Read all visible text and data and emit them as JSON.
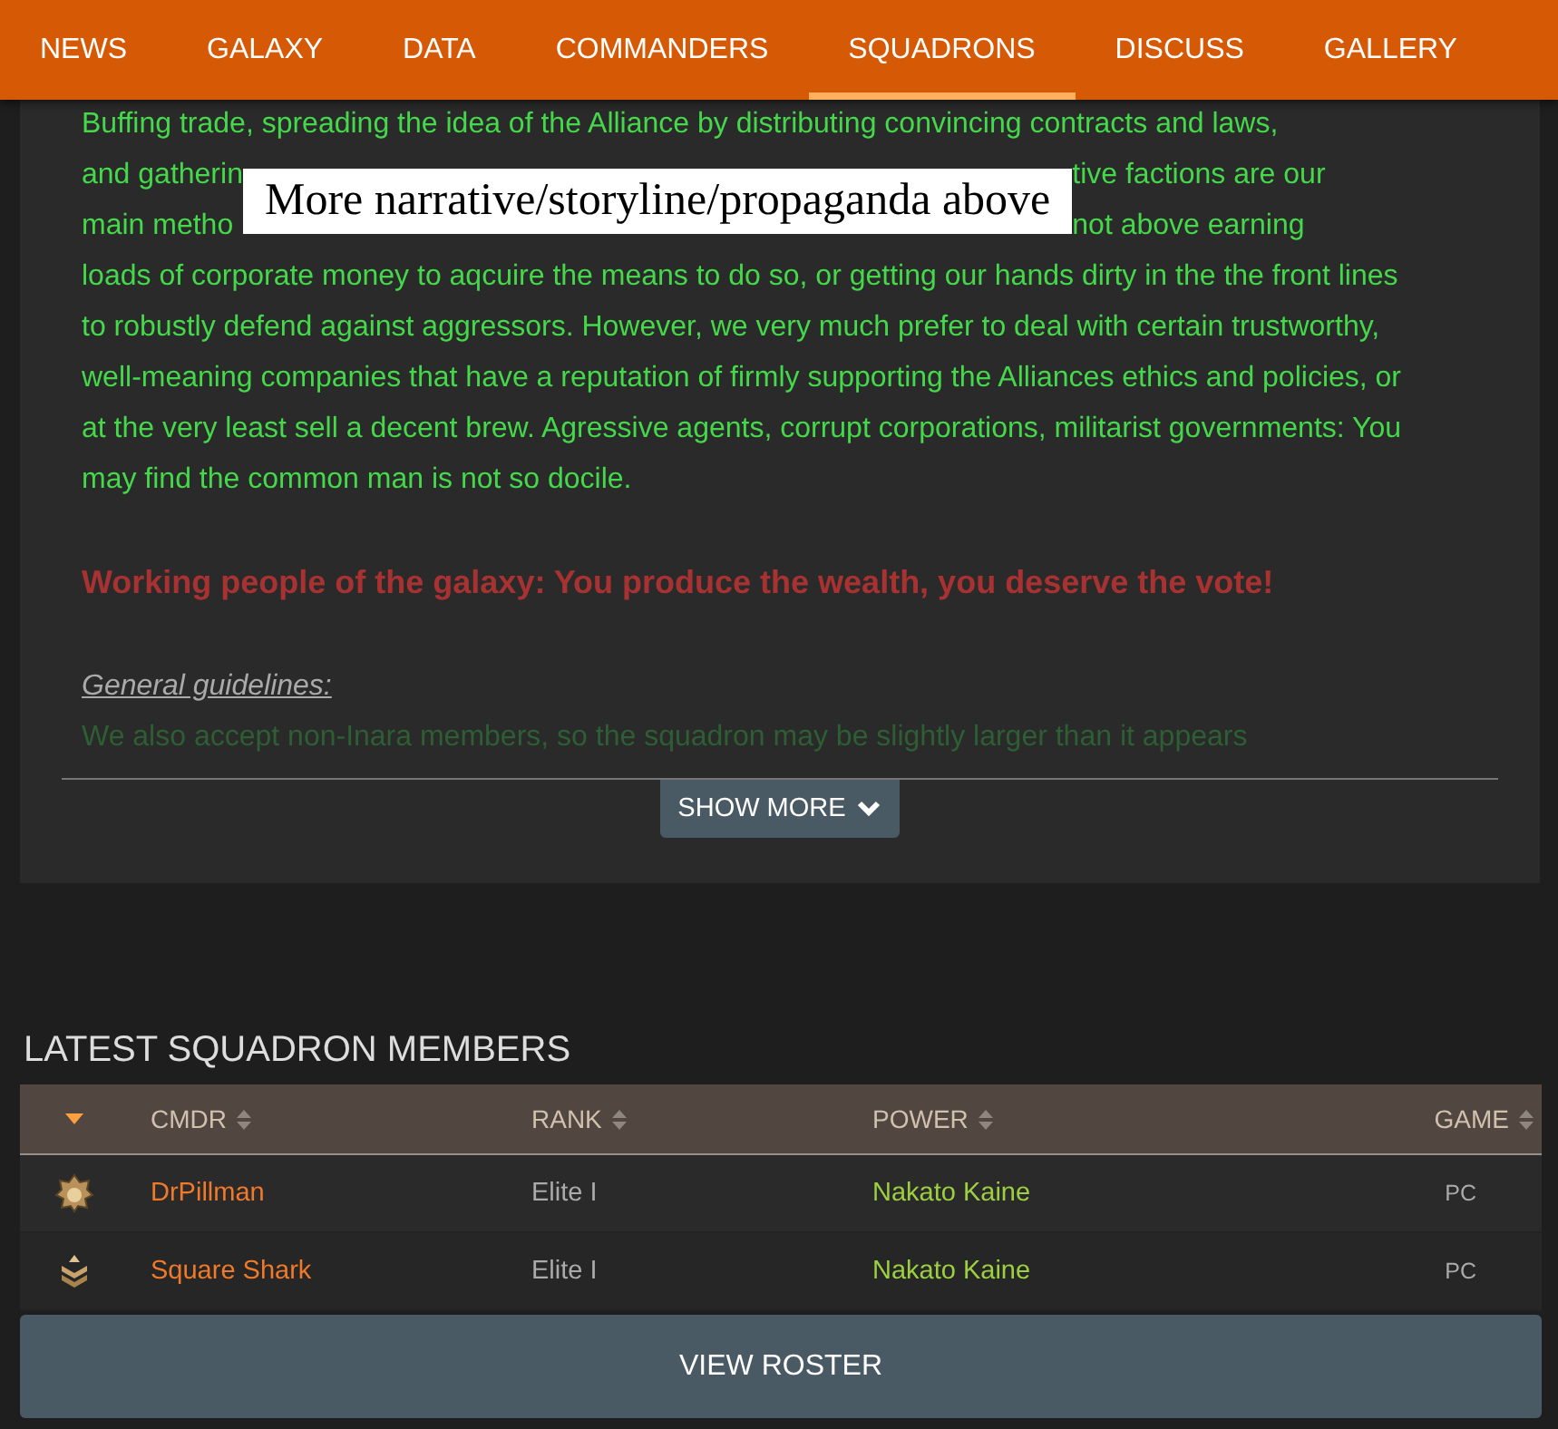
{
  "nav": {
    "tabs": [
      {
        "label": "NEWS",
        "selected": false
      },
      {
        "label": "GALAXY",
        "selected": false
      },
      {
        "label": "DATA",
        "selected": false
      },
      {
        "label": "COMMANDERS",
        "selected": false
      },
      {
        "label": "SQUADRONS",
        "selected": true
      },
      {
        "label": "DISCUSS",
        "selected": false
      },
      {
        "label": "GALLERY",
        "selected": false
      }
    ]
  },
  "description": {
    "first_line": "Buffing trade, spreading the idea of the Alliance by distributing convincing contracts and laws,",
    "covered_lines": [
      {
        "left": "and gatherin",
        "right": "tive factions are our"
      },
      {
        "left": "main metho",
        "right": "not above earning"
      }
    ],
    "annotation": "More narrative/storyline/propaganda above",
    "paragraph": "loads of corporate money to aqcuire the means to do so, or getting our hands dirty in the the front lines to robustly defend against aggressors. However, we very much prefer to deal with certain trustworthy, well-meaning companies that have a reputation of firmly supporting the Alliances ethics and policies, or at the very least sell a decent brew. Agressive agents, corrupt corporations, militarist governments: You may find the common man is not so docile.",
    "slogan": "Working people of the galaxy: You produce the wealth, you deserve the vote!",
    "guidelines_heading": "General guidelines:",
    "faded_line": "We also accept non-Inara members, so the squadron may be slightly larger than it appears",
    "show_more": "SHOW MORE"
  },
  "members": {
    "title": "LATEST SQUADRON MEMBERS",
    "columns": [
      {
        "kind": "icon",
        "sorted": true
      },
      {
        "kind": "text",
        "label": "CMDR",
        "sorted": false
      },
      {
        "kind": "text",
        "label": "RANK",
        "sorted": false
      },
      {
        "kind": "text",
        "label": "POWER",
        "sorted": false
      },
      {
        "kind": "text",
        "label": "GAME",
        "sorted": false
      }
    ],
    "rows": [
      {
        "kind": "badge",
        "cmdr": "DrPillman",
        "rank": "Elite I",
        "power": "Nakato Kaine",
        "game": "PC"
      },
      {
        "kind": "chevrons",
        "cmdr": "Square Shark",
        "rank": "Elite I",
        "power": "Nakato Kaine",
        "game": "PC"
      }
    ],
    "view_roster": "VIEW ROSTER"
  }
}
